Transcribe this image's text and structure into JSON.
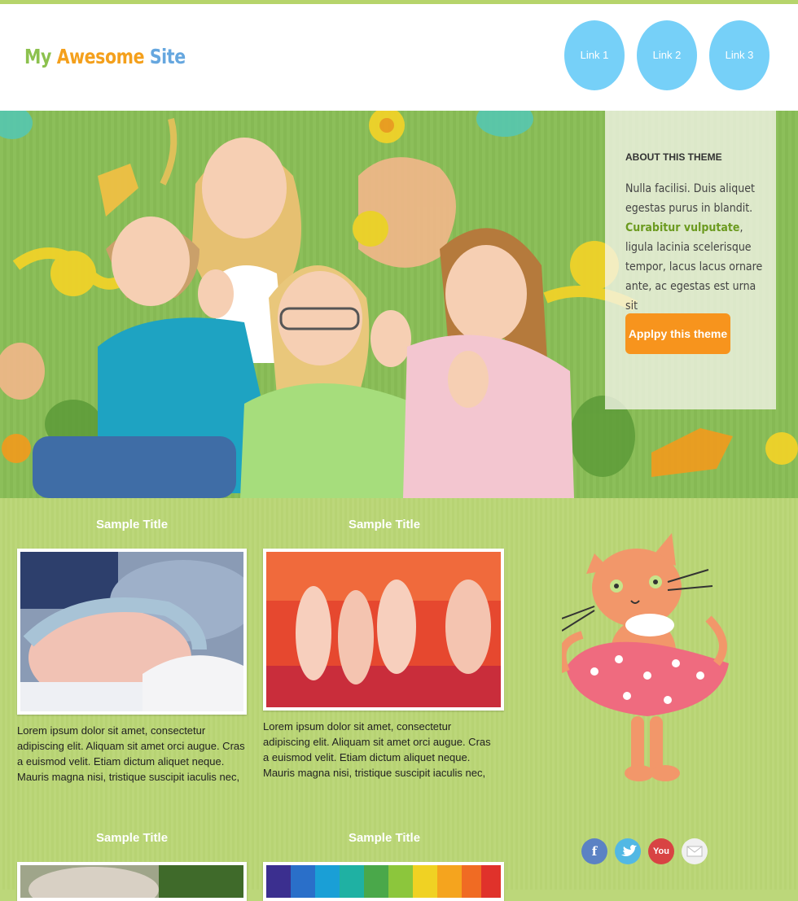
{
  "site": {
    "logo": {
      "part1": "My",
      "part2": "Awesome",
      "part3": "Site"
    }
  },
  "nav": [
    {
      "label": "Link 1"
    },
    {
      "label": "Link 2"
    },
    {
      "label": "Link 3"
    }
  ],
  "about": {
    "title": "ABOUT THIS THEME",
    "text_before": "Nulla facilisi. Duis aliquet egestas purus in blandit.",
    "link": "Curabitur vulputate",
    "text_after": ", ligula lacinia scelerisque tempor, lacus lacus ornare ante, ac egestas est urna sit",
    "button": "Applpy this theme"
  },
  "posts": [
    {
      "title": "Sample Title",
      "text": "Lorem ipsum dolor sit amet, consectetur adipiscing elit. Aliquam sit amet orci augue. Cras a euismod velit. Etiam dictum aliquet neque. Mauris magna nisi, tristique suscipit iaculis nec,"
    },
    {
      "title": "Sample Title",
      "text": "Lorem ipsum dolor sit amet, consectetur adipiscing elit. Aliquam sit amet orci augue. Cras a euismod velit. Etiam dictum aliquet neque. Mauris magna nisi, tristique suscipit iaculis nec,"
    },
    {
      "title": "Sample Title"
    },
    {
      "title": "Sample Title"
    }
  ],
  "social": [
    {
      "icon": "facebook-icon",
      "glyph": "f"
    },
    {
      "icon": "twitter-icon",
      "glyph": ""
    },
    {
      "icon": "youtube-icon",
      "glyph": "You"
    },
    {
      "icon": "email-icon",
      "glyph": ""
    }
  ],
  "colors": {
    "accent_green": "#8cc14e",
    "accent_orange": "#f7941d",
    "accent_blue": "#76d0f8",
    "background": "#bcd77a"
  }
}
